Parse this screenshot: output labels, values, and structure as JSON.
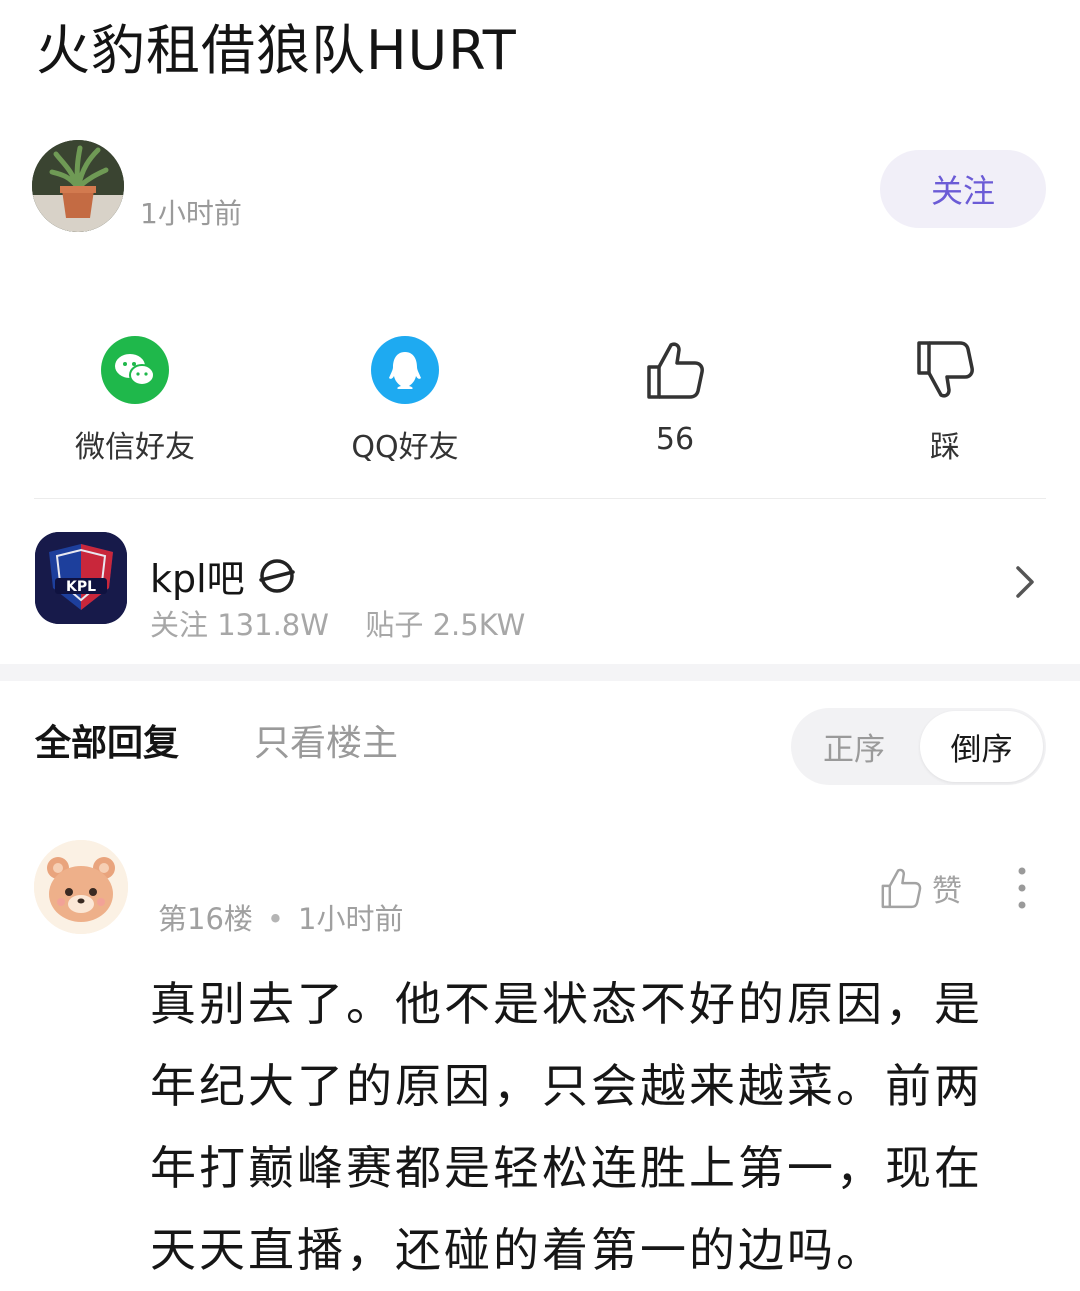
{
  "post": {
    "title": "火豹租借狼队HURT",
    "time": "1小时前",
    "follow_label": "关注"
  },
  "share": {
    "wechat_label": "微信好友",
    "qq_label": "QQ好友",
    "like_count": "56",
    "dislike_label": "踩"
  },
  "forum": {
    "name": "kpl吧",
    "followers": "关注 131.8W",
    "posts": "贴子 2.5KW",
    "logo_text": "KPL"
  },
  "replies": {
    "tab_all": "全部回复",
    "tab_op": "只看楼主",
    "sort_asc": "正序",
    "sort_desc": "倒序"
  },
  "comment": {
    "floor": "第16楼",
    "time": "1小时前",
    "like_label": "赞",
    "lines": [
      "真别去了。他不是状态不好的原因，是",
      "年纪大了的原因，只会越来越菜。前两",
      "年打巅峰赛都是轻松连胜上第一，现在",
      "天天直播，还碰的着第一的边吗。"
    ]
  },
  "colors": {
    "accent": "#6b5bd6",
    "wechat": "#1fb84b",
    "qq": "#1eaaf1"
  }
}
